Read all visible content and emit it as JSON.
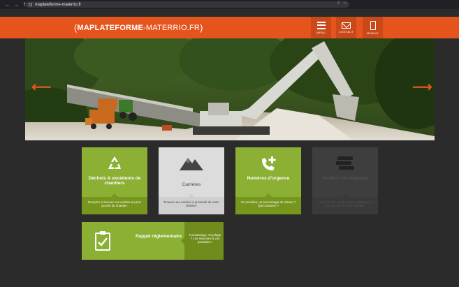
{
  "browser": {
    "url": "maplateforme-materrio.fr"
  },
  "header": {
    "logo_bold": "MAPLATEFORME",
    "logo_sep": "-",
    "logo_light": "MATERRIO.FR",
    "nav": [
      {
        "label": "MENU",
        "icon": "menu-icon"
      },
      {
        "label": "CONTACT",
        "icon": "mail-icon"
      },
      {
        "label": "MOBILE",
        "icon": "phone-icon"
      }
    ],
    "accent": "#e6541e"
  },
  "tiles": [
    {
      "title": "Déchets & excédents de chantiers",
      "desc": "Recycler et trouver vos centres au plus proche du chantier.",
      "icon": "recycle-icon",
      "color": "#8cb034"
    },
    {
      "title": "Carrières",
      "desc": "Trouver une carrière à proximité de votre chantier.",
      "icon": "mountain-icon",
      "color": "#dcdcdc"
    },
    {
      "title": "Numéros d'urgence",
      "desc": "Un accident, un accrochage de réseau ? Qui contacter ?",
      "icon": "phone-plus-icon",
      "color": "#8cb034"
    },
    {
      "title": "Vendeurs de matériaux",
      "desc": "Localiser des vendeurs de matériaux au plus proche de votre chantier.",
      "icon": "stack-icon",
      "color": "#3e3e3e"
    }
  ],
  "wide_tile": {
    "title": "Rappel réglementaire",
    "desc": "Concassage, recyclage ? Les réponses à vos questions !",
    "icon": "clipboard-check-icon"
  }
}
